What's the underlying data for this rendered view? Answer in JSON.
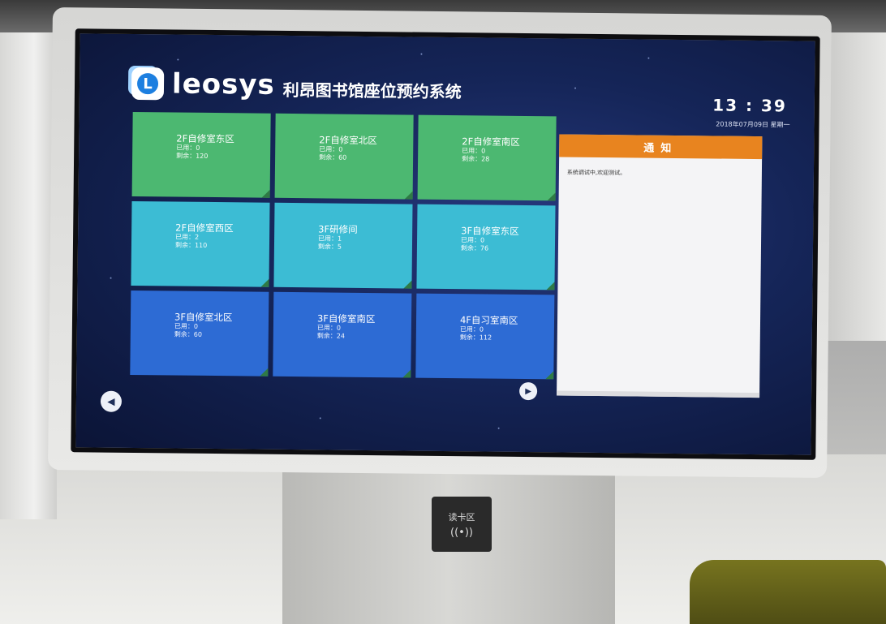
{
  "app": {
    "brand": "leosys",
    "logo_letter": "L",
    "system_title": "利昂图书馆座位预约系统",
    "clock": "13 : 39",
    "date": "2018年07月09日 星期一"
  },
  "rooms": [
    {
      "name": "2F自修室东区",
      "used": "已用：0",
      "remaining": "剩余：120",
      "color": "#4cb871"
    },
    {
      "name": "2F自修室北区",
      "used": "已用：0",
      "remaining": "剩余：60",
      "color": "#4cb871"
    },
    {
      "name": "2F自修室南区",
      "used": "已用：0",
      "remaining": "剩余：28",
      "color": "#4cb871"
    },
    {
      "name": "2F自修室西区",
      "used": "已用：2",
      "remaining": "剩余：110",
      "color": "#3cbcd4"
    },
    {
      "name": "3F研修间",
      "used": "已用：1",
      "remaining": "剩余：5",
      "color": "#3cbcd4"
    },
    {
      "name": "3F自修室东区",
      "used": "已用：0",
      "remaining": "剩余：76",
      "color": "#3cbcd4"
    },
    {
      "name": "3F自修室北区",
      "used": "已用：0",
      "remaining": "剩余：60",
      "color": "#2d6bd4"
    },
    {
      "name": "3F自修室南区",
      "used": "已用：0",
      "remaining": "剩余：24",
      "color": "#2d6bd4"
    },
    {
      "name": "4F自习室南区",
      "used": "已用：0",
      "remaining": "剩余：112",
      "color": "#2d6bd4"
    }
  ],
  "pager": {
    "prev_icon": "◀",
    "next_icon": "▶"
  },
  "notice": {
    "title": "通知",
    "content": "系统调试中,欢迎测试。",
    "accent": "#e8841f"
  },
  "kiosk": {
    "card_reader_label": "读卡区",
    "card_reader_icon": "((•))"
  }
}
